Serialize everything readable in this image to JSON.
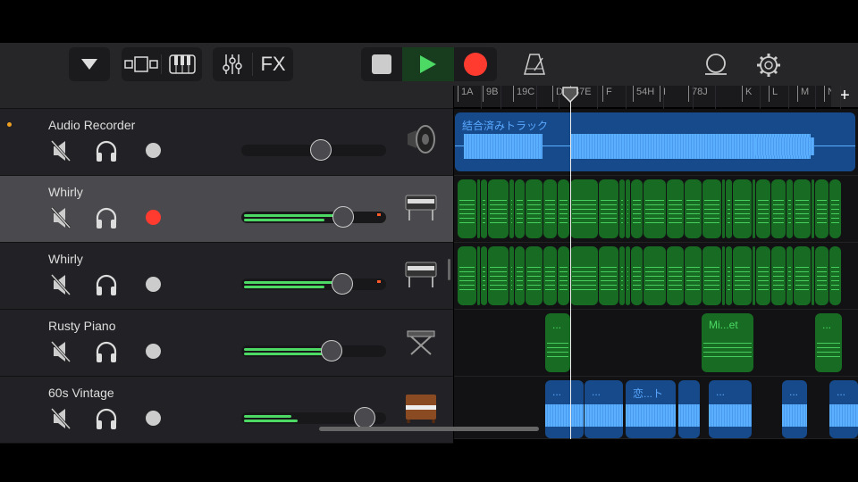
{
  "toolbar": {
    "fx_label": "FX",
    "icons": [
      "triangle-down-icon",
      "tracks-view-icon",
      "keyboard-icon",
      "mixer-icon",
      "stop-icon",
      "play-icon",
      "record-icon",
      "metronome-icon",
      "loop-icon",
      "settings-icon"
    ],
    "play_active": true
  },
  "ruler": {
    "markers": [
      "1A",
      "9B",
      "19C",
      "D",
      "37E",
      "F",
      "54H",
      "I",
      "78J",
      "K",
      "L",
      "M",
      "N"
    ],
    "add_label": "+"
  },
  "tracks": [
    {
      "name": "Audio Recorder",
      "record_armed": false,
      "volume": 0.57,
      "level": [
        0,
        0
      ],
      "instrument": "speaker-icon",
      "selected": false,
      "indicator": true
    },
    {
      "name": "Whirly",
      "record_armed": true,
      "volume": 0.74,
      "level": [
        0.74,
        0.6
      ],
      "instrument": "electric-piano-icon",
      "selected": true,
      "indicator": false
    },
    {
      "name": "Whirly",
      "record_armed": false,
      "volume": 0.73,
      "level": [
        0.72,
        0.6
      ],
      "instrument": "electric-piano-icon",
      "selected": false,
      "indicator": false
    },
    {
      "name": "Rusty Piano",
      "record_armed": false,
      "volume": 0.65,
      "level": [
        0.6,
        0.6
      ],
      "instrument": "keyboard-stand-icon",
      "selected": false,
      "indicator": false
    },
    {
      "name": "60s Vintage",
      "record_armed": false,
      "volume": 0.9,
      "level": [
        0.35,
        0.4
      ],
      "instrument": "upright-piano-icon",
      "selected": false,
      "indicator": false
    }
  ],
  "regions": {
    "merged": "結合済みトラック",
    "row4": [
      "...",
      "Mi...et",
      "..."
    ],
    "row5": [
      "...",
      "...",
      "恋...ト",
      "",
      "...",
      "...",
      "..."
    ]
  },
  "colors": {
    "midi_region": "#176b22",
    "audio_region": "#174a8a",
    "record": "#ff3b30",
    "play": "#4cd964"
  }
}
